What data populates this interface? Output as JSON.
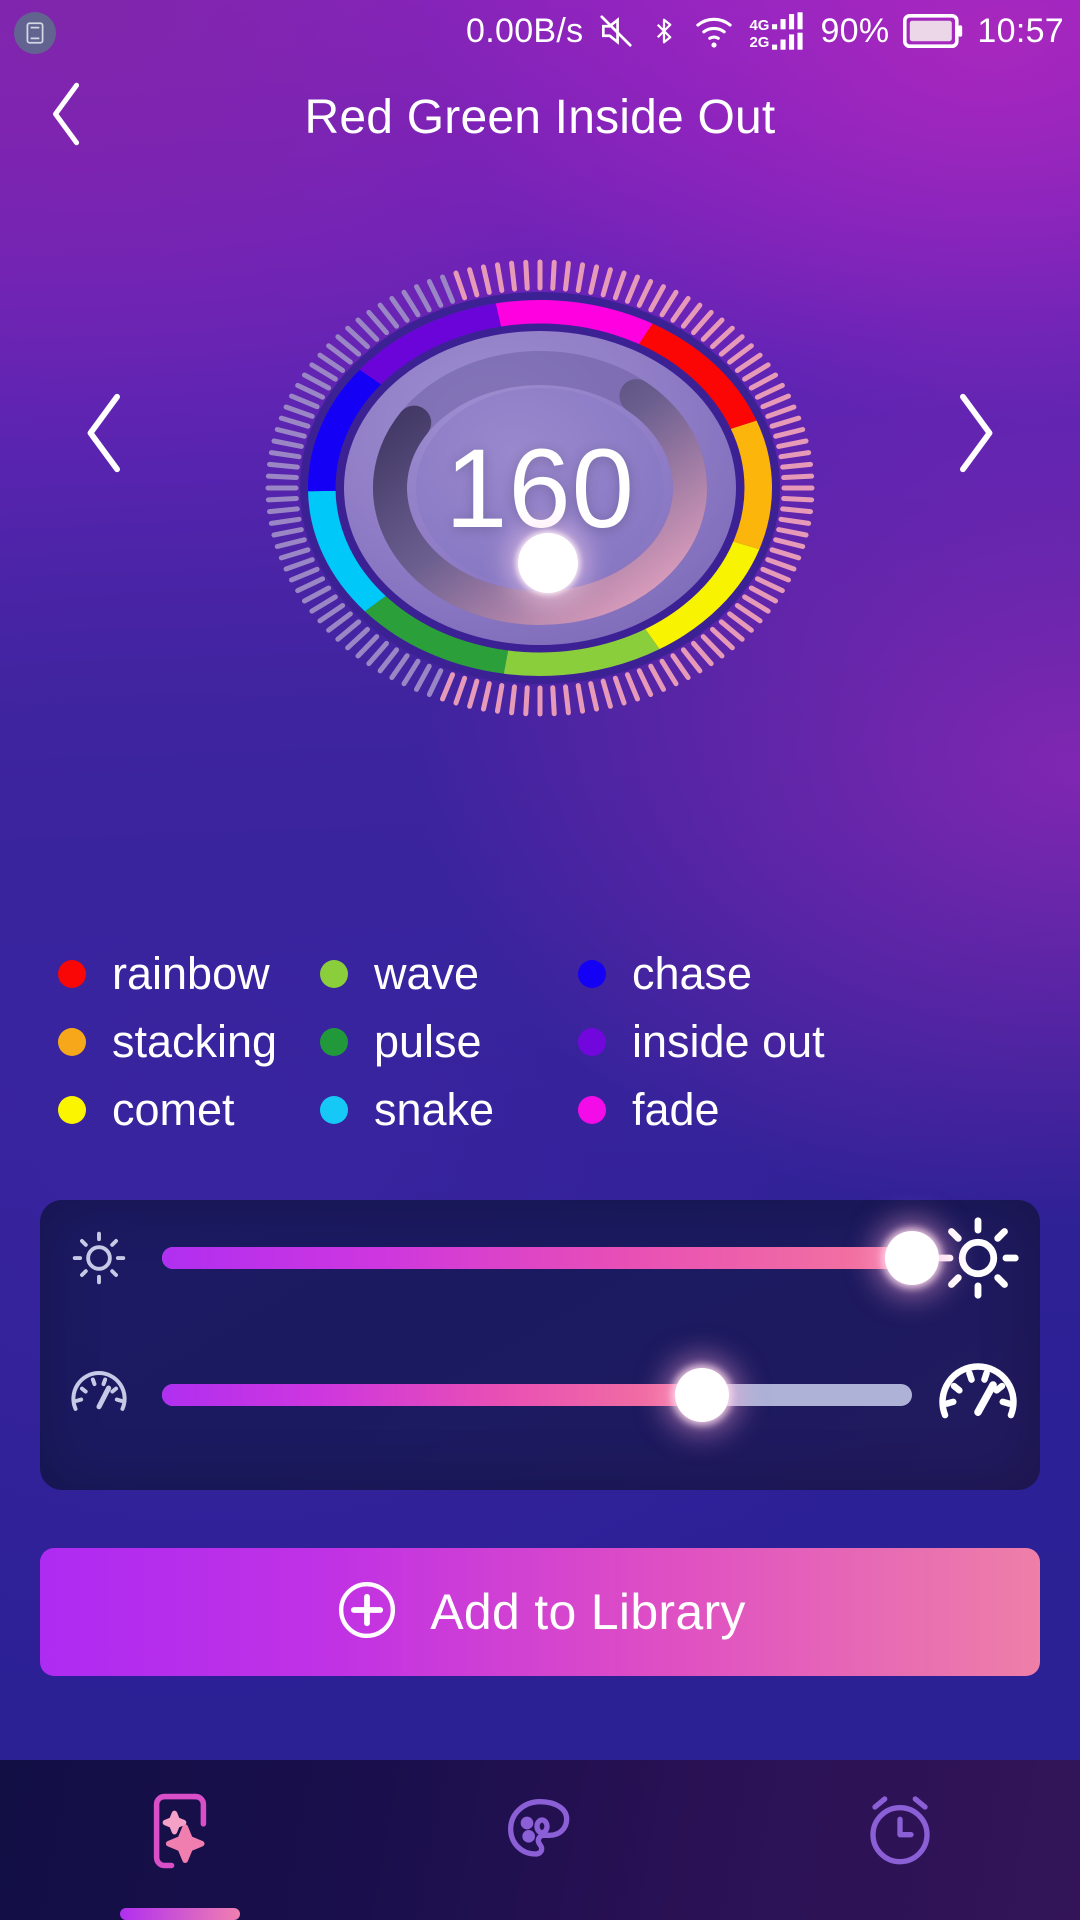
{
  "status_bar": {
    "screenshot_icon": "screenshot-icon",
    "network_speed": "0.00B/s",
    "mute_icon": "mute-icon",
    "bluetooth_icon": "bluetooth-icon",
    "wifi_icon": "wifi-icon",
    "signal_4g_label": "4G",
    "signal_2g_label": "2G",
    "battery_percent": "90%",
    "battery_icon": "battery-icon",
    "clock": "10:57"
  },
  "header": {
    "back_icon": "chevron-left-icon",
    "title": "Red Green Inside Out"
  },
  "dial": {
    "value": "160",
    "prev_icon": "chevron-left-icon",
    "next_icon": "chevron-right-icon",
    "knob_icon": "dial-knob",
    "max": "255",
    "segment_colors": [
      "#ff00e0",
      "#fb0505",
      "#fcb50a",
      "#f8f300",
      "#8ace3c",
      "#2ba03a",
      "#00c8f8",
      "#1300f5",
      "#6a04d8"
    ]
  },
  "modes": {
    "columns": [
      [
        {
          "label": "rainbow",
          "color": "#f90606"
        },
        {
          "label": "stacking",
          "color": "#f7a81a"
        },
        {
          "label": "comet",
          "color": "#fbf500"
        }
      ],
      [
        {
          "label": "wave",
          "color": "#8ace3c"
        },
        {
          "label": "pulse",
          "color": "#21983a"
        },
        {
          "label": "snake",
          "color": "#16c8f5"
        }
      ],
      [
        {
          "label": "chase",
          "color": "#1300f5"
        },
        {
          "label": "inside out",
          "color": "#7207dd"
        },
        {
          "label": "fade",
          "color": "#f40ce8"
        }
      ]
    ]
  },
  "sliders": {
    "brightness": {
      "name": "brightness",
      "low_icon": "brightness-low-icon",
      "high_icon": "brightness-high-icon",
      "percent": 100
    },
    "speed": {
      "name": "speed",
      "low_icon": "speed-low-icon",
      "high_icon": "speed-high-icon",
      "percent": 72
    }
  },
  "add_button": {
    "icon": "plus-circle-icon",
    "label": "Add to Library"
  },
  "bottom_nav": {
    "items": [
      {
        "name": "effects",
        "icon": "effects-sparkle-icon",
        "active": true
      },
      {
        "name": "palette",
        "icon": "palette-icon",
        "active": false
      },
      {
        "name": "timer",
        "icon": "alarm-clock-icon",
        "active": false
      }
    ]
  }
}
